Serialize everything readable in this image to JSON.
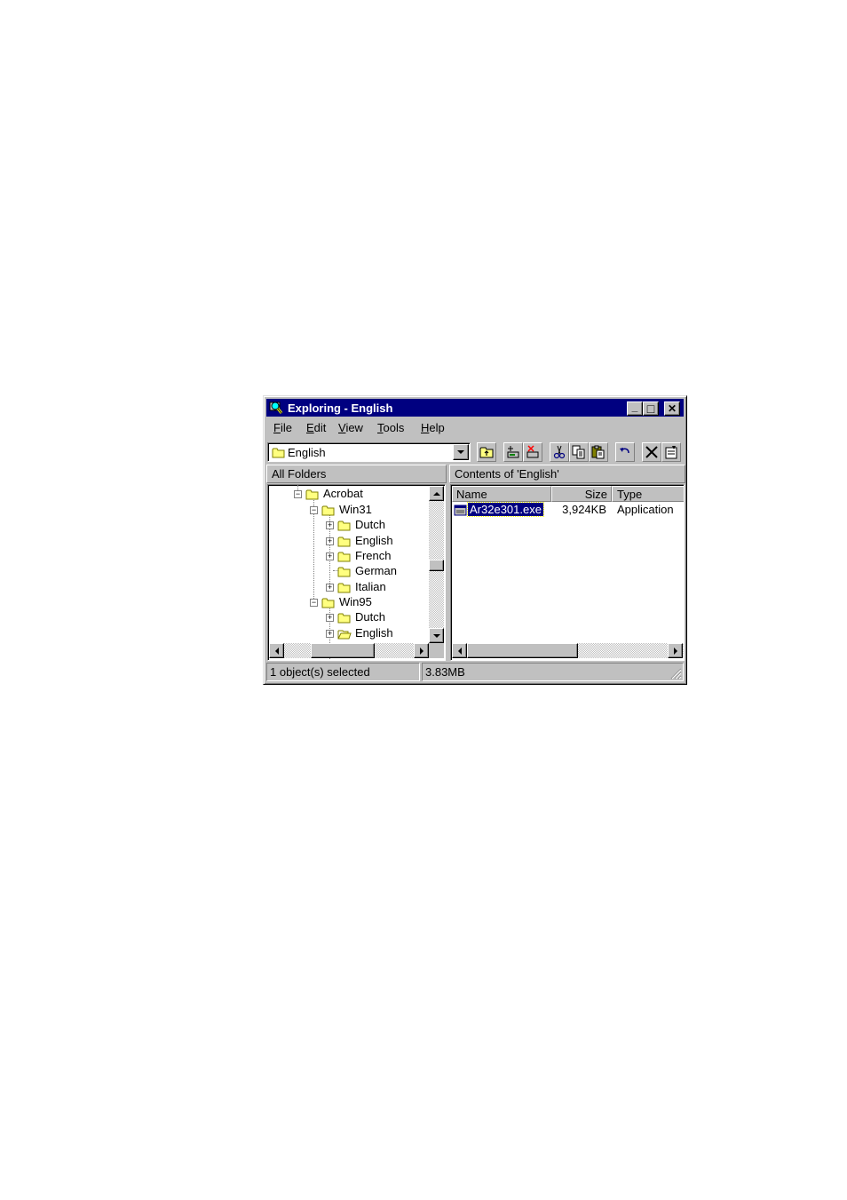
{
  "window": {
    "title": "Exploring - English",
    "title_color": "#000080",
    "controls": {
      "minimize": "_",
      "maximize": "□",
      "close": "✕"
    }
  },
  "menubar": {
    "file": "File",
    "edit": "Edit",
    "view": "View",
    "tools": "Tools",
    "help": "Help"
  },
  "toolbar": {
    "address_value": "English",
    "buttons": [
      "up-one-level",
      "map-network-drive",
      "disconnect-drive",
      "cut",
      "copy",
      "paste",
      "undo",
      "delete",
      "properties"
    ]
  },
  "left_pane": {
    "header": "All Folders",
    "tree": [
      {
        "label": "Acrobat",
        "expander": "−"
      },
      {
        "label": "Win31",
        "expander": "−"
      },
      {
        "label": "Dutch",
        "expander": "+"
      },
      {
        "label": "English",
        "expander": "+"
      },
      {
        "label": "French",
        "expander": "+"
      },
      {
        "label": "German",
        "expander": ""
      },
      {
        "label": "Italian",
        "expander": "+"
      },
      {
        "label": "Win95",
        "expander": "−"
      },
      {
        "label": "Dutch",
        "expander": "+"
      },
      {
        "label": "English",
        "expander": "+"
      }
    ]
  },
  "right_pane": {
    "header": "Contents of 'English'",
    "columns": {
      "name": "Name",
      "size": "Size",
      "type": "Type"
    },
    "files": [
      {
        "name": "Ar32e301.exe",
        "size": "3,924KB",
        "type": "Application",
        "selected": true
      }
    ],
    "selection_color": "#000080"
  },
  "status": {
    "selected": "1 object(s) selected",
    "total_size": "3.83MB"
  }
}
